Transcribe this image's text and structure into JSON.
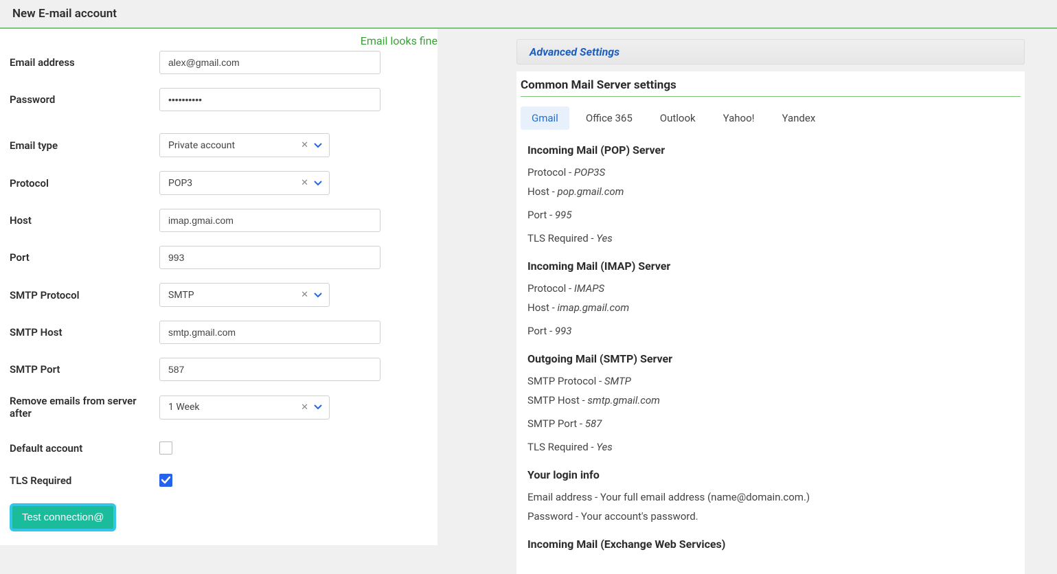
{
  "header": {
    "title": "New E-mail account"
  },
  "validation": {
    "message": "Email looks fine"
  },
  "form": {
    "email_label": "Email address",
    "email_value": "alex@gmail.com",
    "password_label": "Password",
    "password_value": "••••••••••",
    "emailtype_label": "Email type",
    "emailtype_value": "Private account",
    "protocol_label": "Protocol",
    "protocol_value": "POP3",
    "host_label": "Host",
    "host_value": "imap.gmai.com",
    "port_label": "Port",
    "port_value": "993",
    "smtp_protocol_label": "SMTP Protocol",
    "smtp_protocol_value": "SMTP",
    "smtp_host_label": "SMTP Host",
    "smtp_host_value": "smtp.gmail.com",
    "smtp_port_label": "SMTP Port",
    "smtp_port_value": "587",
    "remove_label": "Remove emails from server after",
    "remove_value": "1 Week",
    "default_label": "Default account",
    "tls_label": "TLS Required",
    "test_button": "Test connection@"
  },
  "advanced": {
    "header": "Advanced Settings",
    "title": "Common Mail Server settings",
    "tabs": [
      "Gmail",
      "Office 365",
      "Outlook",
      "Yahoo!",
      "Yandex"
    ],
    "active_tab": "Gmail",
    "pop": {
      "heading": "Incoming Mail (POP) Server",
      "protocol_label": "Protocol - ",
      "protocol_value": "POP3S",
      "host_label": "Host - ",
      "host_value": "pop.gmail.com",
      "port_label": "Port - ",
      "port_value": "995",
      "tls_label": "TLS Required - ",
      "tls_value": "Yes"
    },
    "imap": {
      "heading": "Incoming Mail (IMAP) Server",
      "protocol_label": "Protocol - ",
      "protocol_value": "IMAPS",
      "host_label": "Host - ",
      "host_value": "imap.gmail.com",
      "port_label": "Port - ",
      "port_value": "993"
    },
    "smtp": {
      "heading": "Outgoing Mail (SMTP) Server",
      "protocol_label": "SMTP Protocol - ",
      "protocol_value": "SMTP",
      "host_label": "SMTP Host - ",
      "host_value": "smtp.gmail.com",
      "port_label": "SMTP Port - ",
      "port_value": "587",
      "tls_label": "TLS Required - ",
      "tls_value": "Yes"
    },
    "login": {
      "heading": "Your login info",
      "email_line": "Email address - Your full email address (name@domain.com.)",
      "password_line": "Password - Your account's password."
    },
    "exchange": {
      "heading": "Incoming Mail (Exchange Web Services)"
    }
  }
}
